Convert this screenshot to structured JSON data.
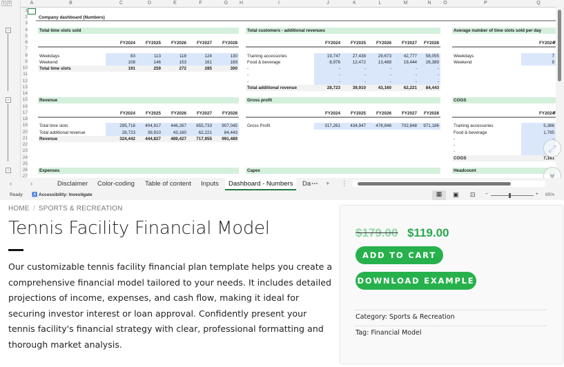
{
  "spreadsheet": {
    "columns": [
      "A",
      "B",
      "C",
      "D",
      "E",
      "F",
      "G",
      "H",
      "I",
      "J",
      "K",
      "L",
      "M",
      "N",
      "O",
      "P",
      "Q"
    ],
    "outline_levels": [
      "1",
      "2"
    ],
    "sheet_title": "Company dashboard (Numbers)",
    "years": [
      "FY2024",
      "FY2025",
      "FY2026",
      "FY2027",
      "FY2028"
    ],
    "blocks": [
      {
        "side": "left",
        "title_row": 4,
        "title": "Total time slots sold",
        "rows": [
          [
            "Weekdays",
            "83",
            "113",
            "118",
            "124",
            "130"
          ],
          [
            "Weekend",
            "108",
            "146",
            "153",
            "161",
            "169"
          ]
        ],
        "total": [
          "Total time slots",
          "191",
          "259",
          "272",
          "285",
          "300"
        ]
      },
      {
        "side": "mid",
        "title_row": 4,
        "title": "Total customers - additional revenues",
        "rows": [
          [
            "Training accessories",
            "19,747",
            "27,438",
            "29,673",
            "42,777",
            "58,055"
          ],
          [
            "Food & beverage",
            "8,976",
            "12,472",
            "13,488",
            "19,444",
            "26,389"
          ],
          [
            "-",
            "-",
            "-",
            "-",
            "-",
            "-"
          ],
          [
            "-",
            "-",
            "-",
            "-",
            "-",
            "-"
          ],
          [
            "-",
            "-",
            "-",
            "-",
            "-",
            "-"
          ]
        ],
        "total": [
          "Total additional revenue",
          "28,723",
          "39,910",
          "43,160",
          "62,221",
          "84,443"
        ]
      },
      {
        "side": "right",
        "title_row": 4,
        "title": "Average number of time slots sold per day",
        "rows": [
          [
            "Weekdays",
            "7"
          ],
          [
            "Weekend",
            "9"
          ]
        ],
        "total": null
      },
      {
        "side": "left",
        "title_row": 15,
        "title": "Revenue",
        "rows": [
          [
            "Total time slots",
            "295,718",
            "404,917",
            "446,267",
            "655,733",
            "907,045"
          ],
          [
            "Total additional revenue",
            "28,723",
            "39,910",
            "43,160",
            "62,221",
            "84,443"
          ]
        ],
        "total": [
          "Revenue",
          "324,442",
          "444,827",
          "489,427",
          "717,955",
          "991,489"
        ]
      },
      {
        "side": "mid",
        "title_row": 15,
        "title": "Gross profit",
        "rows": [
          [
            "Gross Profit",
            "317,261",
            "434,947",
            "478,846",
            "702,848",
            "971,186"
          ]
        ],
        "total": null
      },
      {
        "side": "right",
        "title_row": 15,
        "title": "COGS",
        "rows": [
          [
            "Training accessories",
            "5,386"
          ],
          [
            "Food & beverage",
            "1,795"
          ],
          [
            "-",
            "-"
          ],
          [
            "-",
            ""
          ],
          [
            "-",
            ""
          ]
        ],
        "total": [
          "COGS",
          "7,181"
        ]
      },
      {
        "side": "left",
        "title_row": 26,
        "title": "Expenses",
        "rows": [],
        "total": null,
        "header": false
      },
      {
        "side": "mid",
        "title_row": 26,
        "title": "Capex",
        "rows": [],
        "total": null,
        "header": false
      },
      {
        "side": "right",
        "title_row": 26,
        "title": "Headcount",
        "rows": [],
        "total": null,
        "header": false
      }
    ],
    "tabs": [
      "Disclaimer",
      "Color-coding",
      "Table of content",
      "Inputs",
      "Dashboard - Numbers",
      "Da"
    ],
    "active_tab": "Dashboard - Numbers",
    "status": "Ready",
    "accessibility": "Accessibility: Investigate",
    "zoom": "85%"
  },
  "product": {
    "breadcrumb": [
      "HOME",
      "SPORTS & RECREATION"
    ],
    "title": "Tennis Facility Financial Model",
    "description": "Our customizable tennis facility financial plan template helps you create a comprehensive financial model tailored to your needs. It includes detailed projections of income, expenses, and cash flow, making it ideal for securing investor interest or loan approval. Confidently present your tennis facility's financial strategy with clear, professional formatting and thorough market analysis.",
    "old_price": "$179.00",
    "price": "$119.00",
    "add_to_cart": "ADD TO CART",
    "download": "DOWNLOAD EXAMPLE",
    "category_label": "Category:",
    "category": "Sports & Recreation",
    "tag_label": "Tag:",
    "tag": "Financial Model",
    "accent_color": "#27b14c"
  }
}
